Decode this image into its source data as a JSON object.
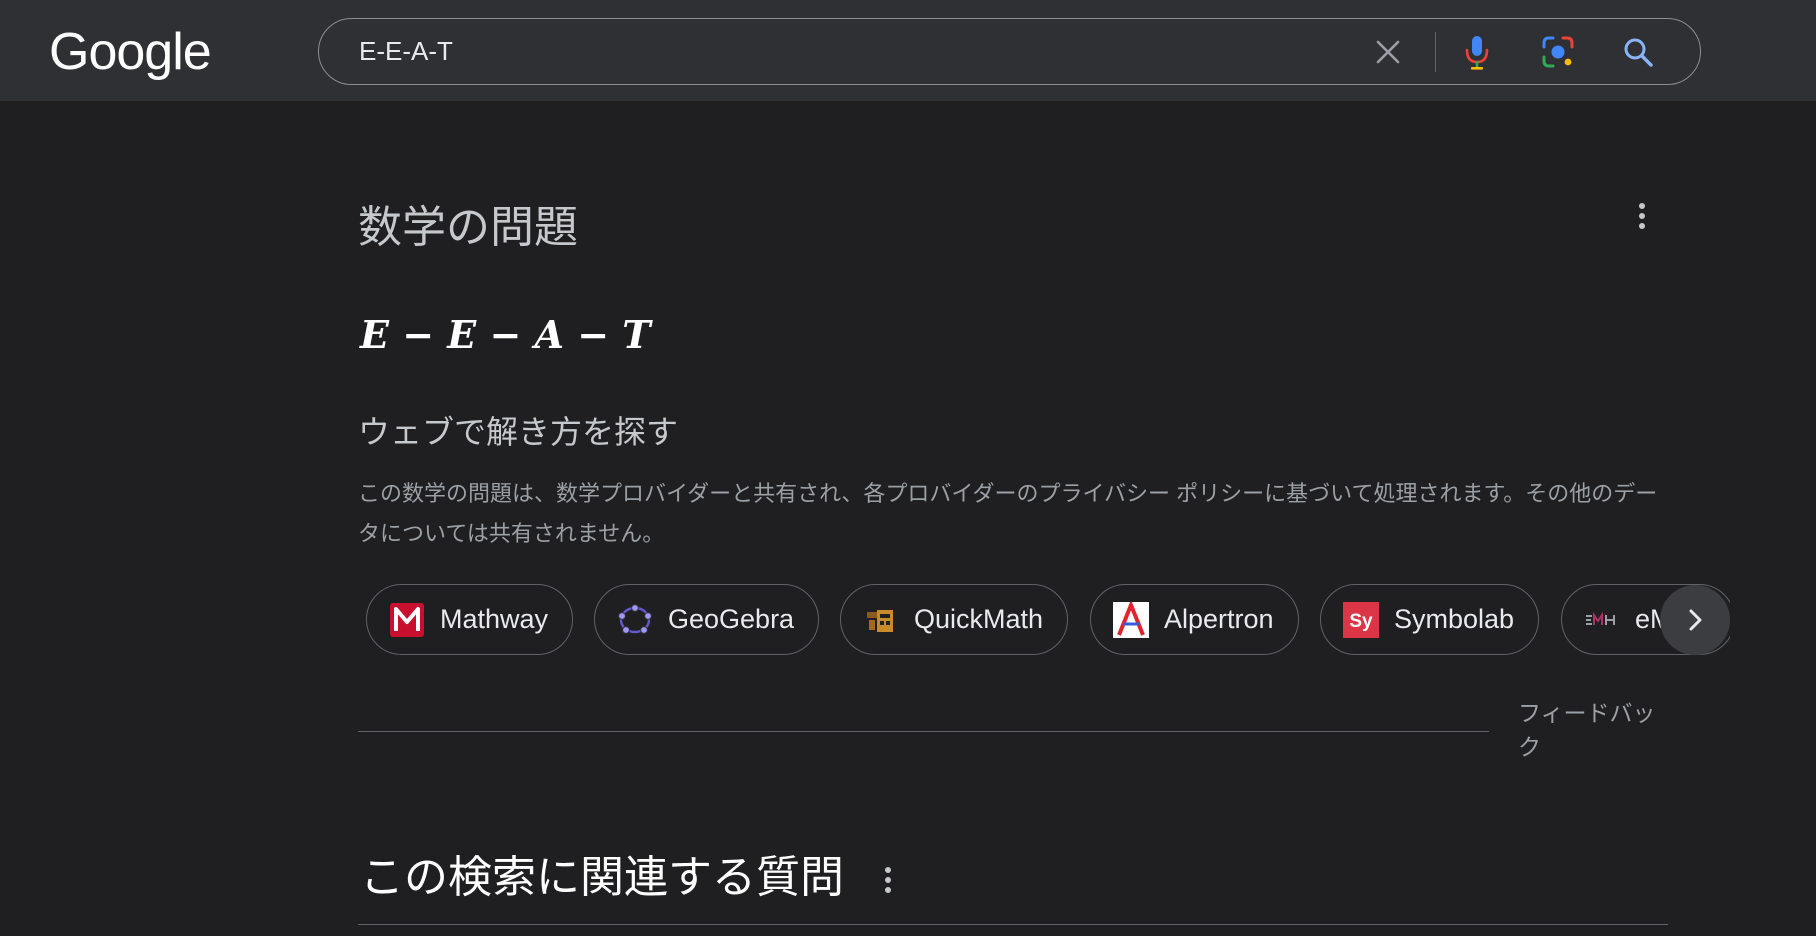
{
  "header": {
    "logo_text": "Google",
    "search": {
      "value": "E-E-A-T",
      "clear_icon": "close-icon",
      "voice_icon": "mic-icon",
      "lens_icon": "lens-icon",
      "submit_icon": "search-icon"
    }
  },
  "math_card": {
    "title": "数学の問題",
    "expression": "E − E − A − T",
    "subheading": "ウェブで解き方を探す",
    "disclaimer": "この数学の問題は、数学プロバイダーと共有され、各プロバイダーのプライバシー ポリシーに基づいて処理されます。その他のデータについては共有されません。",
    "providers": [
      {
        "label": "Mathway",
        "icon": "mathway-logo",
        "color": "#c8102e"
      },
      {
        "label": "GeoGebra",
        "icon": "geogebra-logo",
        "color": "#6557d2"
      },
      {
        "label": "QuickMath",
        "icon": "quickmath-logo",
        "color": "#c98a2b"
      },
      {
        "label": "Alpertron",
        "icon": "alpertron-logo",
        "color": "#e0232f"
      },
      {
        "label": "Symbolab",
        "icon": "symbolab-logo",
        "color": "#dc3545"
      },
      {
        "label": "eMath",
        "icon": "emath-logo",
        "color": "#b0306a"
      }
    ],
    "next_icon": "chevron-right-icon",
    "feedback": "フィードバック"
  },
  "related": {
    "title": "この検索に関連する質問"
  },
  "colors": {
    "background": "#1f1f21",
    "header": "#2f3034",
    "border": "#5f6368",
    "text_primary": "#e8eaed",
    "text_secondary": "#9aa0a6"
  }
}
